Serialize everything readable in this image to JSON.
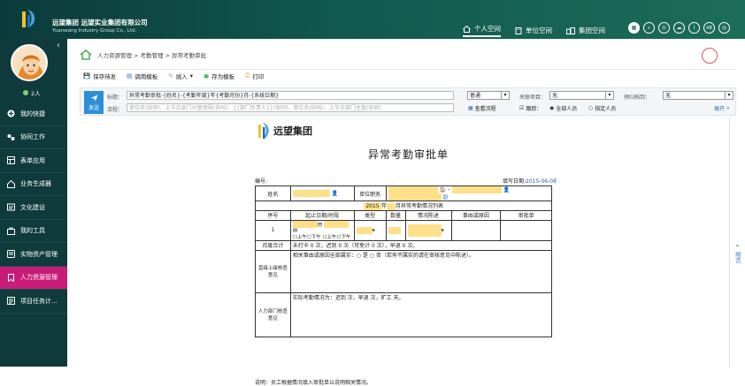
{
  "header": {
    "company_cn": "远望集团    远望实业集团有限公司",
    "company_en": "Yuanwang Industry Group Co., Ltd.",
    "nav": [
      {
        "label": "个人空间",
        "icon": "home-icon"
      },
      {
        "label": "单位空间",
        "icon": "building-icon"
      },
      {
        "label": "集团空间",
        "icon": "group-icon"
      }
    ],
    "circle_icons": [
      "apps-icon",
      "search-icon",
      "zoom-icon",
      "cloud-icon",
      "info-icon",
      "ab-icon",
      "settings-icon"
    ],
    "circle_text_ab": "AB"
  },
  "sidebar": {
    "online_count": "2人",
    "items": [
      {
        "label": "我的快捷",
        "icon": "plus-circle-icon"
      },
      {
        "label": "协同工作",
        "icon": "collab-icon"
      },
      {
        "label": "表单应用",
        "icon": "table-icon"
      },
      {
        "label": "业务生成器",
        "icon": "builder-icon"
      },
      {
        "label": "文化建设",
        "icon": "culture-icon"
      },
      {
        "label": "我的工具",
        "icon": "tools-icon"
      },
      {
        "label": "实物资产管理",
        "icon": "asset-icon"
      },
      {
        "label": "人力资源管理",
        "icon": "hr-icon"
      },
      {
        "label": "项目任务计...",
        "icon": "project-icon"
      }
    ],
    "active_index": 7,
    "active_color": "#c81c78"
  },
  "breadcrumb": "人力资源管理 > 考勤管理 > 异常考勤审批",
  "toolbar": {
    "save_draft": "保存待发",
    "use_template": "调用模板",
    "insert": "插入",
    "save_template": "存为模板",
    "print": "打印"
  },
  "compose": {
    "send_label": "发送",
    "title_label": "标题：",
    "title_value": "异常考勤审批-{姓名}-{考勤年度}年{考勤月份}月-{系统日期}",
    "flow_label": "流程：",
    "flow_placeholder": "单位名(协同)、上节点部门分管领导(协同)、{{部门负责人}}(协同)、单位名(协同)、上节点部门主管(协同)",
    "priority_value": "普通",
    "related_label": "关联项目：",
    "related_value": "无",
    "archive_label": "预归档到：",
    "archive_value": "无",
    "view_flow": "查看流程",
    "track_label": "跟踪：",
    "track_all": "全部人员",
    "track_specified": "指定人员",
    "expand": "展开"
  },
  "right_panel": "附言",
  "document": {
    "logo_text": "远望集团",
    "title": "异常考勤审批单",
    "number_label": "编号:",
    "date_label": "填写日期:",
    "date_value": "2015-06-08",
    "name_label": "姓名",
    "position_label": "单位职务",
    "year_value": "2015",
    "year_text": "年",
    "month_text": "月异常考勤情况列表",
    "col_headers": [
      "序号",
      "起止日期/时段",
      "类型",
      "数量",
      "情况陈述",
      "事由或原因",
      "审批单"
    ],
    "row_index": "1",
    "morning": "上午",
    "afternoon": "下午",
    "summary_label": "月度合计",
    "summary_text": "未打卡 0 次，迟到 0 次（可免计 0 次），早退 0 次。",
    "direct_label": "直接上级核查意见",
    "direct_text": "相关事由或原因全部属实：○ 是 ○ 否（若有不属实的请在审核意见中陈述）。",
    "hr_label": "人力部门核查意见",
    "hr_text": "实际考勤情况为：迟到    次，早退    次，旷工    天。",
    "note": "说明：员工根据情况填入审批单以说明相关情况。"
  }
}
